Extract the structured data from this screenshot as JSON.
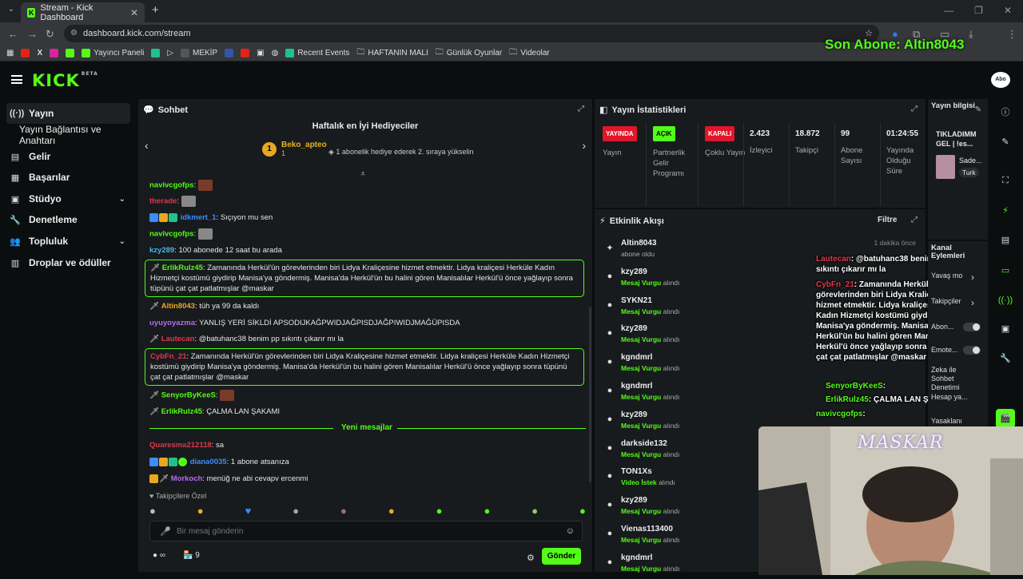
{
  "browser": {
    "tab_title": "Stream - Kick Dashboard",
    "url": "dashboard.kick.com/stream",
    "bookmarks": [
      "Yayıncı Paneli",
      "MEKİP",
      "Recent Events",
      "HAFTANIN MALI",
      "Günlük Oyunlar",
      "Videolar"
    ]
  },
  "overlay": {
    "last_sub": "Son Abone: Altin8043",
    "webcam_label": "MASKAR"
  },
  "header": {
    "logo": "KICK",
    "beta": "BETA",
    "avatar": "Abo"
  },
  "sidebar": {
    "items": [
      {
        "label": "Yayın",
        "icon": "broadcast-icon"
      },
      {
        "label": "Yayın Bağlantısı ve Anahtarı",
        "icon": ""
      },
      {
        "label": "Gelir",
        "icon": "revenue-icon"
      },
      {
        "label": "Başarılar",
        "icon": "achievements-icon"
      },
      {
        "label": "Stüdyo",
        "icon": "studio-icon"
      },
      {
        "label": "Denetleme",
        "icon": "moderation-icon"
      },
      {
        "label": "Topluluk",
        "icon": "community-icon"
      },
      {
        "label": "Droplar ve ödüller",
        "icon": "drops-icon"
      }
    ]
  },
  "chat": {
    "title": "Sohbet",
    "gifters_title": "Haftalık en İyi Hediyeciler",
    "leader_rank": "1",
    "leader_name": "Beko_apteo",
    "leader_count": "1",
    "leader_note": "1 abonelik hediye ederek 2. sıraya yükselin",
    "messages": [
      {
        "user": "navivcgofps",
        "text": "",
        "color": "#53fc18"
      },
      {
        "user": "therade",
        "text": "",
        "color": "#e0364b"
      },
      {
        "user": "idkmert_1",
        "text": "Sıçıyon mu sen",
        "color": "#3a8dff"
      },
      {
        "user": "navivcgofps",
        "text": "",
        "color": "#53fc18"
      },
      {
        "user": "kzy289",
        "text": "100 abonede 12 saat bu arada",
        "color": "#45b6e8"
      },
      {
        "user": "ErlikRulz45",
        "text": "Zamanında Herkül'ün görevlerinden biri Lidya Kraliçesine hizmet etmektir. Lidya kraliçesi Herküle Kadın Hizmetçi kostümü giydirip Manisa'ya göndermiş. Manisa'da Herkül'ün bu halini gören Manisalılar Herkül'ü önce yağlayıp sonra tüpünü çat çat patlatmışlar @maskar",
        "color": "#53fc18"
      },
      {
        "user": "Altin8043",
        "text": "tüh ya 99 da kaldı",
        "color": "#e8a820"
      },
      {
        "user": "uyuyoyazma",
        "text": "YANLIŞ YERİ SİKLDİ APSODIJKAĞPWIDJAĞPISDJAĞPIWIDJMAĞÜPISDA",
        "color": "#b46bf2"
      },
      {
        "user": "Lautecan",
        "text": "@batuhanc38 benim pp sıkıntı çıkarır mı la",
        "color": "#e0364b"
      },
      {
        "user": "CybFn_21",
        "text": "Zamanında Herkül'ün görevlerinden biri Lidya Kraliçesine hizmet etmektir. Lidya kraliçesi Herküle Kadın Hizmetçi kostümü giydirip Manisa'ya göndermiş. Manisa'da Herkül'ün bu halini gören Manisalılar Herkül'ü önce yağlayıp sonra tüpünü çat çat patlatmışlar @maskar",
        "color": "#e0364b"
      },
      {
        "user": "SenyorByKeeS",
        "text": "",
        "color": "#53fc18"
      },
      {
        "user": "ErlikRulz45",
        "text": "ÇALMA LAN ŞAKAMI",
        "color": "#53fc18"
      },
      {
        "user": "Quaresma212118",
        "text": "sa",
        "color": "#e0364b"
      },
      {
        "user": "diana0035",
        "text": "1 abone atsanıza",
        "color": "#3a8dff"
      },
      {
        "user": "Morkoch",
        "text": "menüğ ne abi cevapv ercenmi",
        "color": "#b46bf2"
      }
    ],
    "new_messages": "Yeni mesajlar",
    "followers_only": "Takipçilere Özel",
    "input_placeholder": "Bir mesaj gönderin",
    "points": "9",
    "send": "Gönder"
  },
  "stats": {
    "title": "Yayın İstatistikleri",
    "columns": [
      {
        "pill": "YAYINDA",
        "pill_color": "#e0162b",
        "label": "Yayın"
      },
      {
        "pill": "AÇIK",
        "pill_color": "#53fc18",
        "label": "Partnerlik Gelir Programı"
      },
      {
        "pill": "KAPALI",
        "pill_color": "#e0162b",
        "label": "Çoklu Yayın"
      },
      {
        "value": "2.423",
        "label": "İzleyici"
      },
      {
        "value": "18.872",
        "label": "Takipçi"
      },
      {
        "value": "99",
        "label": "Abone Sayısı"
      },
      {
        "value": "01:24:55",
        "label": "Yayında Olduğu Süre"
      }
    ]
  },
  "activity": {
    "title": "Etkinlik Akışı",
    "filter": "Filtre",
    "events": [
      {
        "name": "Altin8043",
        "pre": "abone oldu",
        "hl": "",
        "post": "",
        "time": "1 dakika önce"
      },
      {
        "name": "kzy289",
        "pre": "",
        "hl": "Mesaj Vurgu",
        "post": " alındı",
        "time": ""
      },
      {
        "name": "SYKN21",
        "pre": "",
        "hl": "Mesaj Vurgu",
        "post": " alındı",
        "time": ""
      },
      {
        "name": "kzy289",
        "pre": "",
        "hl": "Mesaj Vurgu",
        "post": " alındı",
        "time": ""
      },
      {
        "name": "kgndmrl",
        "pre": "",
        "hl": "Mesaj Vurgu",
        "post": " alındı",
        "time": ""
      },
      {
        "name": "kgndmrl",
        "pre": "",
        "hl": "Mesaj Vurgu",
        "post": " alındı",
        "time": ""
      },
      {
        "name": "kzy289",
        "pre": "",
        "hl": "Mesaj Vurgu",
        "post": " alındı",
        "time": ""
      },
      {
        "name": "darkside132",
        "pre": "",
        "hl": "Mesaj Vurgu",
        "post": " alındı",
        "time": ""
      },
      {
        "name": "TON1Xs",
        "pre": "",
        "hl": "Video İstek",
        "post": " alındı",
        "time": ""
      },
      {
        "name": "kzy289",
        "pre": "",
        "hl": "Mesaj Vurgu",
        "post": " alındı",
        "time": ""
      },
      {
        "name": "Vienas113400",
        "pre": "",
        "hl": "Mesaj Vurgu",
        "post": " alındı",
        "time": ""
      },
      {
        "name": "kgndmrl",
        "pre": "",
        "hl": "Mesaj Vurgu",
        "post": " alındı",
        "time": ""
      }
    ]
  },
  "overlay_chat": {
    "line1_user": "Lautecan",
    "line1_text": ": @batuhanc38 benim pp sıkıntı çıkarır mı la",
    "line2_user": "CybFn_21",
    "line2_text": ": Zamanında Herkül'ün görevlerinden biri Lidya Kraliçesine hizmet etmektir. Lidya kraliçesi Herküle Kadın Hizmetçi kostümü giydirip Manisa'ya göndermiş. Manisa'da Herkül'ün bu halini gören Manisalılar Herkül'ü önce yağlayıp sonra tüpünü çat çat patlatmışlar @maskar",
    "line3_user": "SenyorByKeeS",
    "line4_user": "ErlikRulz45",
    "line4_text": ": ÇALMA LAN ŞAKAMI",
    "line5_user": "navivcgofps"
  },
  "info": {
    "title": "Yayın bilgisi",
    "stream_title": "TIKLADIMM GEL | !es...",
    "category": "Sade...",
    "tag": "Turk"
  },
  "channel": {
    "title": "Kanal Eylemleri",
    "items": [
      "Yavaş mo",
      "Takipçiler",
      "Abon...",
      "Emote...",
      "Zeka ile Sohbet Denetimi",
      "Hesap ya...",
      "Yasaklanı"
    ]
  }
}
